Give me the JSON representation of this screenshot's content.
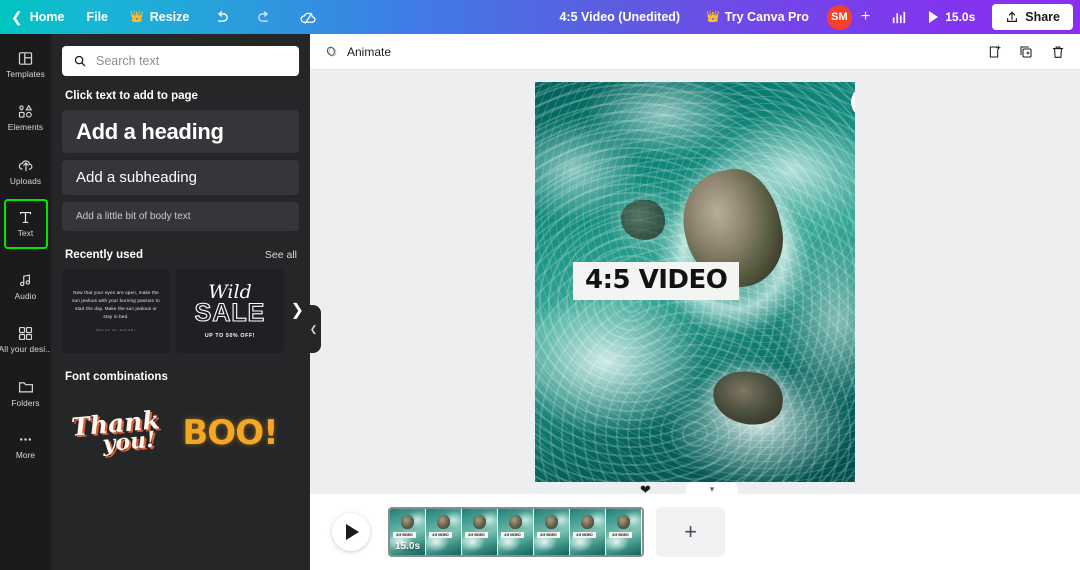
{
  "topbar": {
    "back_label": "",
    "home_label": "Home",
    "file_label": "File",
    "resize_label": "Resize",
    "undo_icon": "undo-icon",
    "redo_icon": "redo-icon",
    "cloud_icon": "cloud-sync-icon",
    "doc_title": "4:5 Video (Unedited)",
    "pro_label": "Try Canva Pro",
    "avatar_initials": "SM",
    "plus_label": "+",
    "stats_icon": "bar-chart-icon",
    "duration_label": "15.0s",
    "share_label": "Share",
    "accent_avatar": "#f6402a"
  },
  "rail": {
    "items": [
      {
        "label": "Templates",
        "icon": "templates-icon",
        "active": false
      },
      {
        "label": "Elements",
        "icon": "elements-icon",
        "active": false
      },
      {
        "label": "Uploads",
        "icon": "uploads-icon",
        "active": false
      },
      {
        "label": "Text",
        "icon": "text-icon",
        "active": true
      },
      {
        "label": "Audio",
        "icon": "audio-icon",
        "active": false
      },
      {
        "label": "All your desi...",
        "icon": "all-designs-icon",
        "active": false
      },
      {
        "label": "Folders",
        "icon": "folders-icon",
        "active": false
      },
      {
        "label": "More",
        "icon": "more-icon",
        "active": false
      }
    ],
    "highlight_color": "#00e800"
  },
  "panel": {
    "search_placeholder": "Search text",
    "click_label": "Click text to add to page",
    "heading_card": "Add a heading",
    "subheading_card": "Add a subheading",
    "body_card": "Add a little bit of body text",
    "recently_used_title": "Recently used",
    "see_all_label": "See all",
    "recent": {
      "quote": "Now that your eyes are open, make the sun jealous with your burning passion to start the day. Make the sun jealous or stay in bed.",
      "quote_attr": "MALAK EL HALABI",
      "sale_script": "Wild",
      "sale_big": "SALE",
      "sale_sub": "UP TO 50% OFF!"
    },
    "font_combinations_title": "Font combinations",
    "fonts": {
      "thank_line1": "Thank",
      "thank_line2": "you!",
      "boo": "BOO!"
    }
  },
  "editor": {
    "animate_label": "Animate",
    "animate_icon": "animate-icon",
    "add_page_icon": "add-page-icon",
    "duplicate_icon": "duplicate-page-icon",
    "delete_icon": "trash-icon",
    "canvas_text": "4:5 VIDEO",
    "rotate_icon": "add-duration-icon"
  },
  "timeline": {
    "play_icon": "play-icon",
    "duration_label": "15.0s",
    "frame_tag": "4:5 VIDEO",
    "frame_count": 7,
    "add_page_label": "+",
    "heart_icon": "heart-icon",
    "collapse_icon": "chevron-down-icon"
  }
}
